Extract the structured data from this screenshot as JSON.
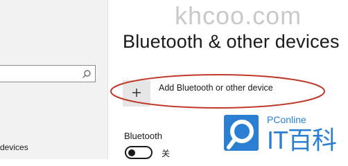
{
  "watermark": {
    "top_text": "khcoo.com"
  },
  "sidebar": {
    "search_placeholder": "",
    "partial_item_label": "devices"
  },
  "main": {
    "title": "Bluetooth & other devices",
    "add_device": {
      "icon": "plus-icon",
      "label": "Add Bluetooth or other device"
    },
    "bluetooth_section": {
      "heading": "Bluetooth",
      "toggle_state_label": "关",
      "toggle_on": false
    }
  },
  "annotation": {
    "ellipse_color": "#c0392b"
  },
  "brand": {
    "sub_label": "PConline",
    "main_label": "IT百科",
    "color": "#2b7fd3"
  }
}
